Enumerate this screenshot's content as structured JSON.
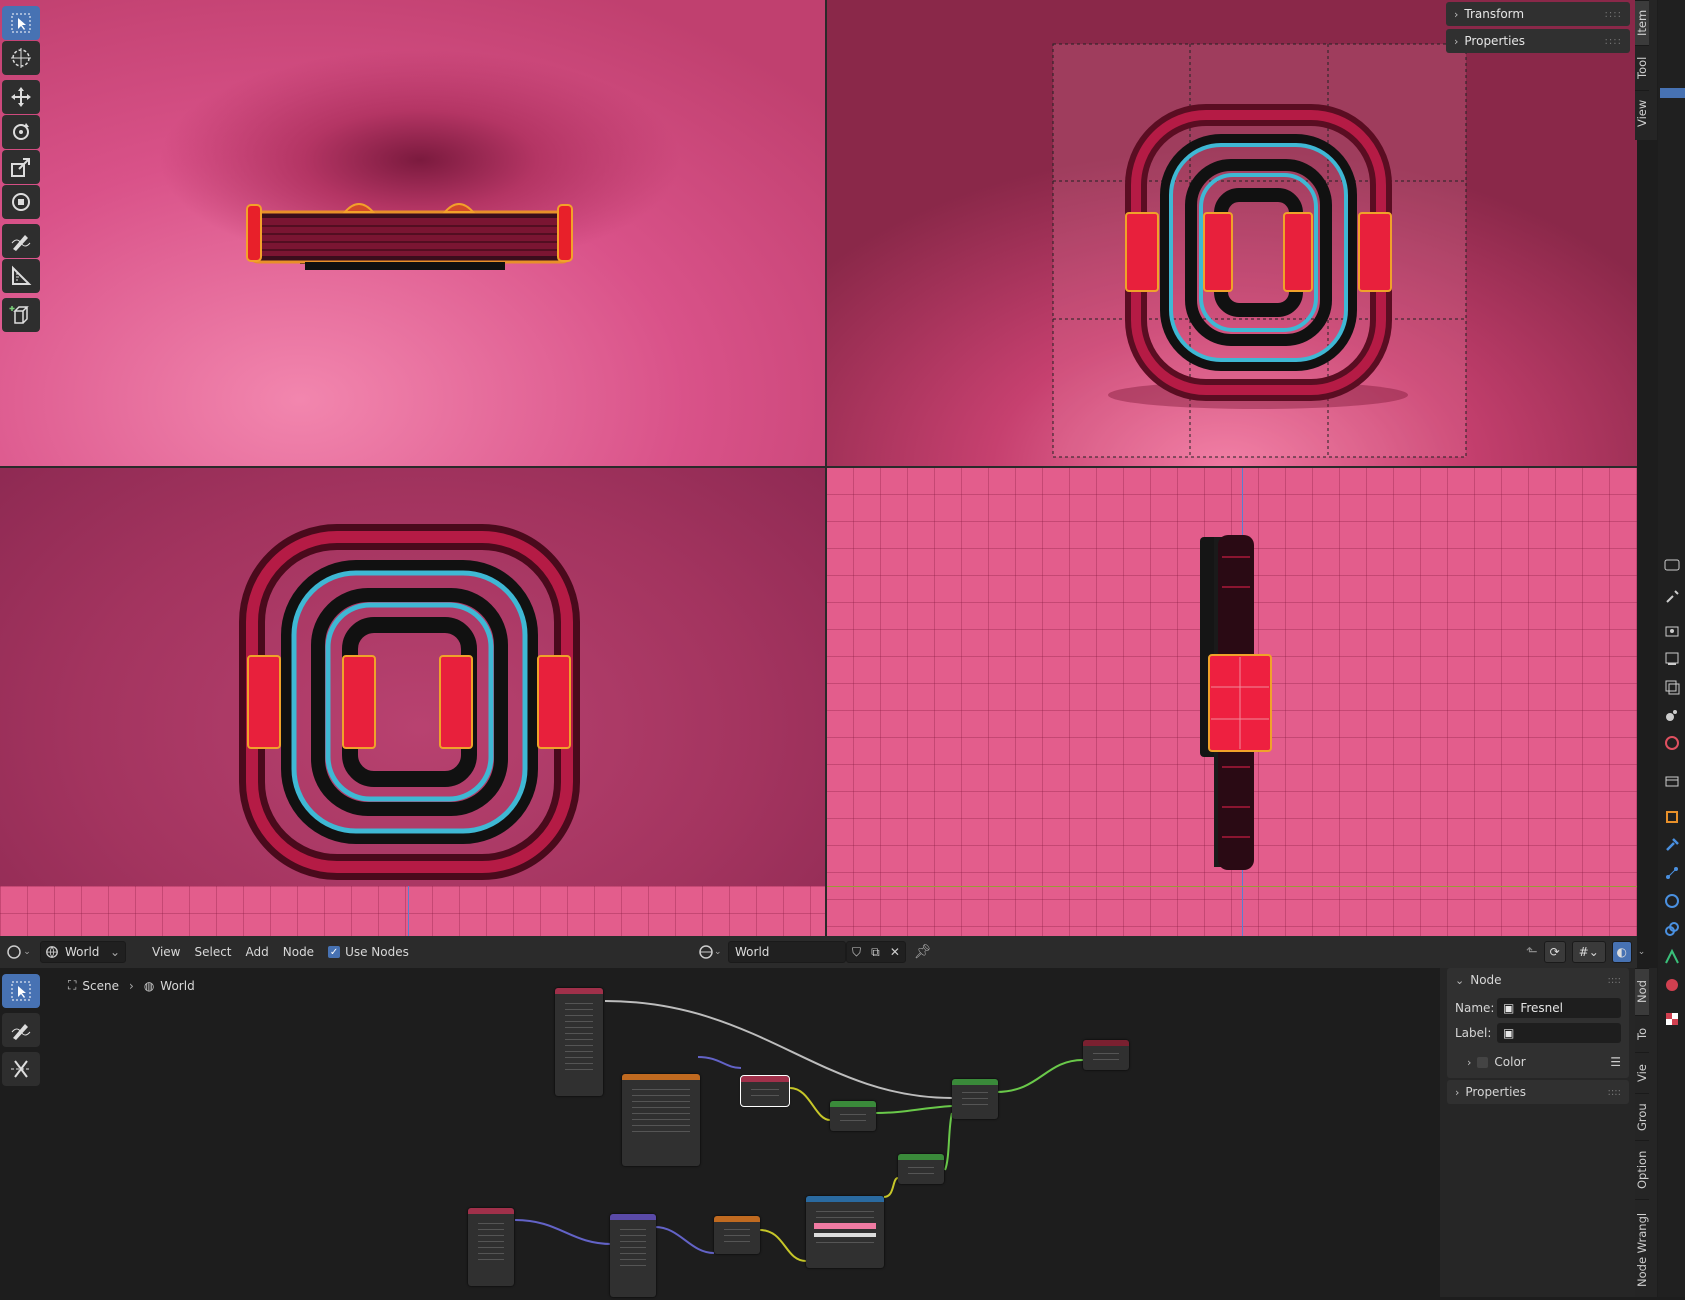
{
  "colors": {
    "accent": "#4772b3",
    "node_link": "#6ac94a",
    "wire_gray": "#bdbdbd",
    "wire_purple": "#6363c7",
    "wire_yellow": "#c7c729"
  },
  "npanel_top": {
    "items": [
      {
        "label": "Transform"
      },
      {
        "label": "Properties"
      }
    ],
    "tabs": [
      "Item",
      "Tool",
      "View"
    ]
  },
  "toolbar": {
    "tools": [
      "select-box-icon",
      "cursor-icon",
      "move-icon",
      "rotate-icon",
      "scale-icon",
      "transform-icon",
      "annotate-icon",
      "measure-icon",
      "add-cube-icon"
    ]
  },
  "node_header": {
    "world_label": "World",
    "menus": [
      "View",
      "Select",
      "Add",
      "Node"
    ],
    "use_nodes_label": "Use Nodes",
    "use_nodes_checked": true,
    "datablock_name": "World"
  },
  "breadcrumb": {
    "scene": "Scene",
    "world": "World"
  },
  "node_panel": {
    "section_title": "Node",
    "name_label": "Name:",
    "name_value": "Fresnel",
    "label_label": "Label:",
    "label_value": "",
    "color_label": "Color",
    "properties_label": "Properties",
    "tabs": [
      "Nod",
      "To",
      "Vie",
      "Grou",
      "Option",
      "Node Wrangl"
    ]
  }
}
